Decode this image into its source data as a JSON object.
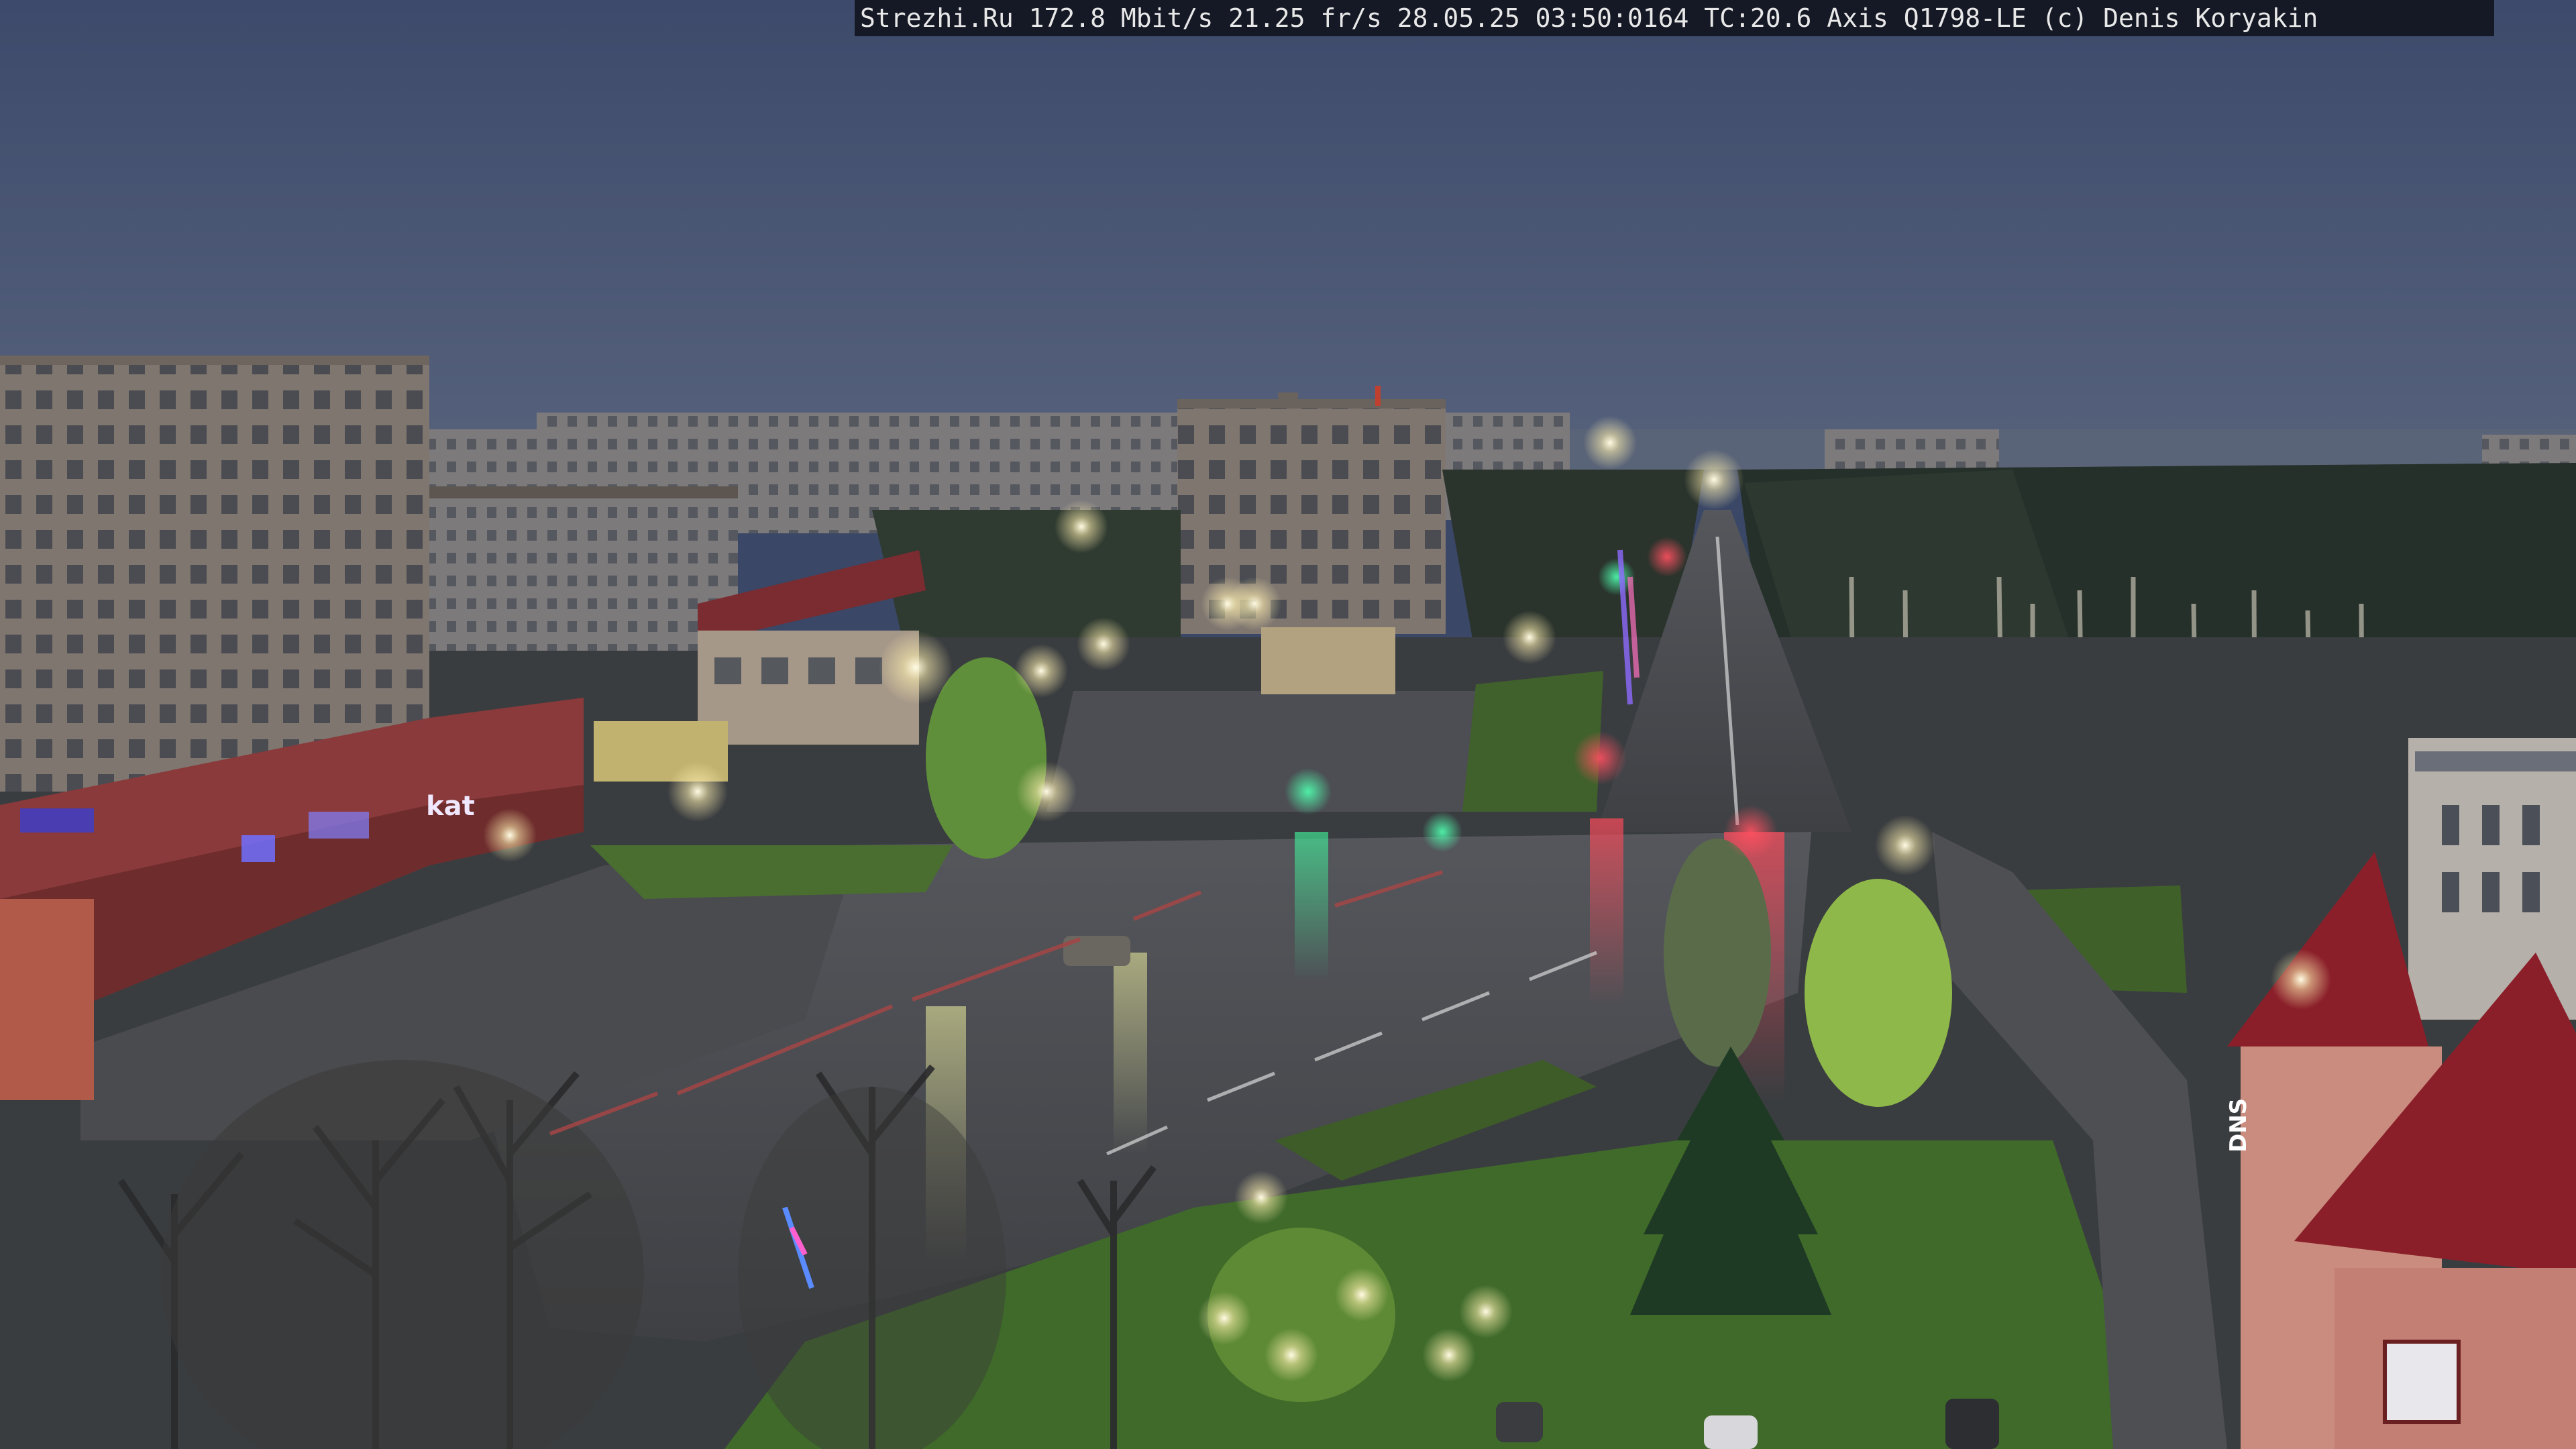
{
  "overlay": {
    "text": "Strezhi.Ru 172.8 Mbit/s 21.25 fr/s 28.05.25 03:50:0164 TC:20.6  Axis Q1798-LE  (c) Denis Koryakin"
  },
  "signs": {
    "store_left": "kat",
    "tower_right": "DNS"
  },
  "colors": {
    "sky": "#3f4d70",
    "asphalt": "#45474c",
    "grass": "#3f6a2a",
    "brick": "#8a3a3a",
    "lamp": "#fff6d8"
  }
}
